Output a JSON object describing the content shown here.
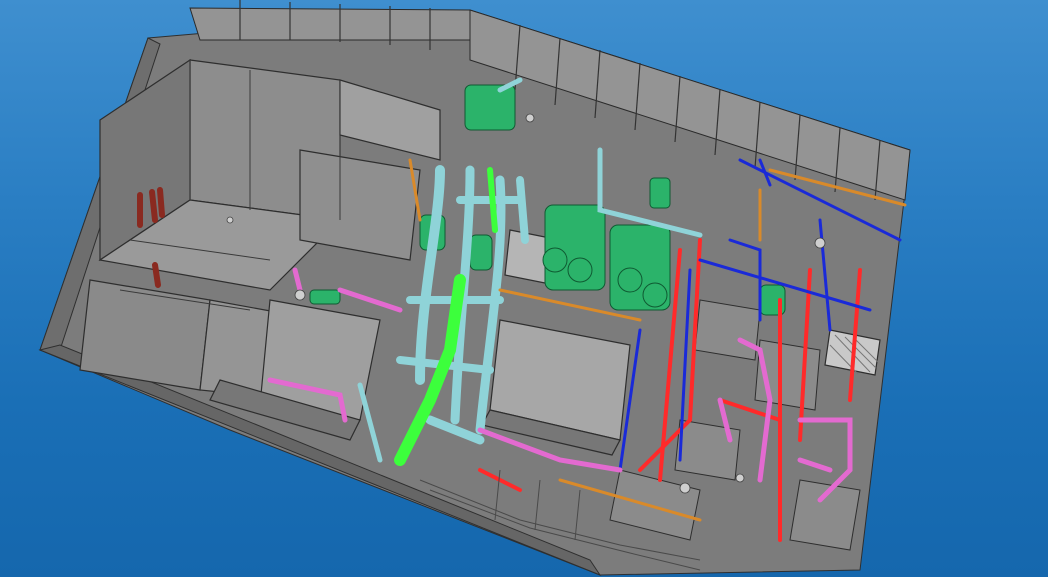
{
  "viewport": {
    "background_top": "#3f8fcf",
    "background_bottom": "#1567ad"
  },
  "model": {
    "hull_color": "#8a8a8a",
    "bulkhead_color": "#9b9b9b",
    "edge_color": "#3a3a3a",
    "pipe_colors": {
      "seawater": "#8fd3d8",
      "fuel": "#ff2a2a",
      "fresh_water": "#1a2ad8",
      "lube_oil": "#e36ad0",
      "bilge": "#d8a0e0",
      "equipment": "#2bb36a",
      "highlight": "#3cff3c",
      "steam": "#d98a2a",
      "cable": "#ffffff"
    }
  }
}
